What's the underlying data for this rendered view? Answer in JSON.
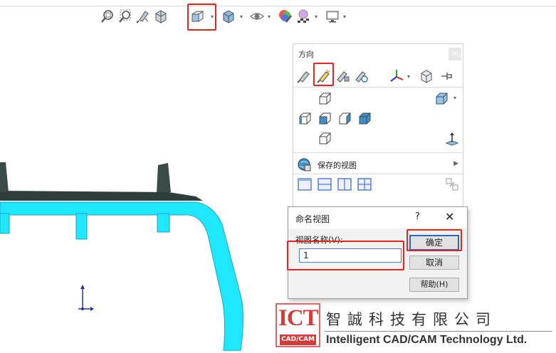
{
  "colors": {
    "accent": "#2c66c8",
    "highlight": "#e8221d",
    "model_fill": "#1ee7ff",
    "model_dark": "#2d3b3b",
    "ict_red": "#d63a3a"
  },
  "toolbar": {
    "icons": [
      "zoom-to-fit-icon",
      "zoom-area-icon",
      "previous-view-icon",
      "section-view-icon",
      "view-orientation-icon",
      "display-style-icon",
      "hide-show-items-icon",
      "edit-appearance-icon",
      "apply-scene-icon",
      "view-settings-icon"
    ]
  },
  "orientation_panel": {
    "title": "方向",
    "close": "×",
    "saved_views_label": "保存的视图"
  },
  "dialog": {
    "title": "命名视图",
    "help_symbol": "?",
    "close_symbol": "✕",
    "field_label": "视图名称(V):",
    "field_value": "1",
    "ok_label": "确定",
    "cancel_label": "取消",
    "help_label": "帮助(H)"
  },
  "logo": {
    "ict": "ICT",
    "ict_sub": "CAD/CAM",
    "company_cn": "智誠科技有限公司",
    "company_en": "Intelligent CAD/CAM Technology Ltd."
  }
}
